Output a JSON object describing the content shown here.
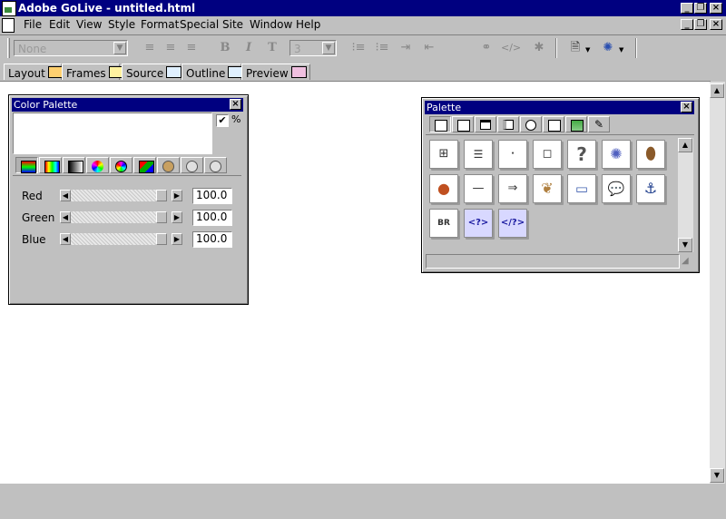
{
  "window": {
    "title": "Adobe GoLive - untitled.html",
    "caption_min": "_",
    "caption_restore": "❐",
    "caption_close": "×"
  },
  "menu": {
    "items": [
      "File",
      "Edit",
      "View",
      "Style",
      "Format",
      "Special",
      "Site",
      "Window",
      "Help"
    ]
  },
  "toolbar": {
    "paragraph_select": "None",
    "size_select": "3",
    "bold": "B",
    "italic": "I",
    "teletype": "T"
  },
  "view_tabs": [
    "Layout",
    "Frames",
    "Source",
    "Outline",
    "Preview"
  ],
  "color_palette": {
    "title": "Color Palette",
    "percent_label": "%",
    "percent_checked": true,
    "sliders": [
      {
        "label": "Red",
        "value": "100.0"
      },
      {
        "label": "Green",
        "value": "100.0"
      },
      {
        "label": "Blue",
        "value": "100.0"
      }
    ],
    "tab_icons": [
      "gray-swatch-icon",
      "rgb-swatch-icon",
      "gradient-swatch-icon",
      "color-wheel-icon",
      "hsv-wheel-icon",
      "web-cube-icon",
      "named-colors-icon",
      "site-colors-icon",
      "pantone-icon"
    ]
  },
  "object_palette": {
    "title": "Palette",
    "tab_icons": [
      "basic-objects-icon",
      "forms-icon",
      "head-icon",
      "frames-icon",
      "site-icon",
      "custom-icon",
      "css-icon",
      "draw-icon"
    ],
    "items_row1": [
      "layout-grid-icon",
      "layout-text-box-icon",
      "floating-box-icon",
      "table-icon",
      "unknown-object-icon",
      "plugin-icon",
      "java-applet-icon"
    ],
    "items_row2": [
      "activex-icon",
      "line-icon",
      "spacer-icon",
      "image-icon",
      "marquee-icon",
      "comment-icon",
      "anchor-icon"
    ],
    "items_row3": [
      {
        "icon": "line-break-icon",
        "label": "BR"
      },
      {
        "icon": "tag-icon",
        "label": "<?>"
      },
      {
        "icon": "end-tag-icon",
        "label": "</?>"
      }
    ]
  }
}
